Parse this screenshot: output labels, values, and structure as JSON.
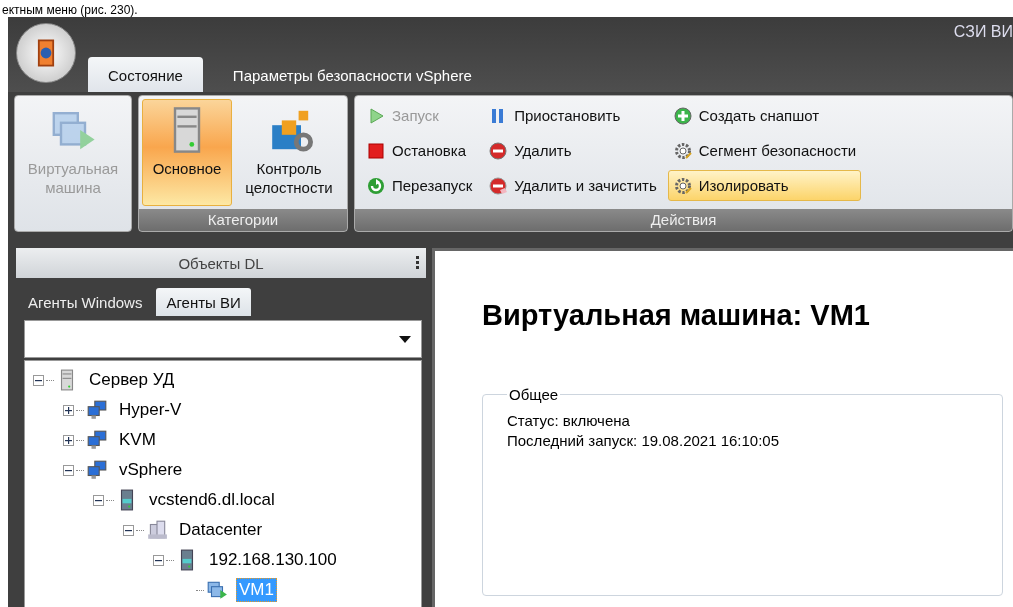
{
  "document_text": "ектным меню (рис. 230).",
  "window": {
    "title": "СЗИ ВИ"
  },
  "tabs": [
    {
      "label": "Состояние",
      "selected": true
    },
    {
      "label": "Параметры безопасности vSphere",
      "selected": false
    }
  ],
  "ribbon": {
    "groups": [
      {
        "buttons": [
          {
            "label": "Виртуальная машина",
            "kind": "vm",
            "disabled": true,
            "selected": false
          }
        ]
      },
      {
        "label": "Категории",
        "buttons": [
          {
            "label": "Основное",
            "kind": "server",
            "disabled": false,
            "selected": true
          },
          {
            "label": "Контроль целостности",
            "kind": "cubes",
            "disabled": false,
            "selected": false
          }
        ]
      }
    ],
    "actions": {
      "label": "Действия",
      "columns": [
        [
          {
            "label": "Запуск",
            "kind": "play",
            "disabled": true,
            "selected": false
          },
          {
            "label": "Остановка",
            "kind": "stop",
            "disabled": false,
            "selected": false
          },
          {
            "label": "Перезапуск",
            "kind": "restart",
            "disabled": false,
            "selected": false
          }
        ],
        [
          {
            "label": "Приостановить",
            "kind": "pause",
            "disabled": false,
            "selected": false
          },
          {
            "label": "Удалить",
            "kind": "delete",
            "disabled": false,
            "selected": false
          },
          {
            "label": "Удалить и зачистить",
            "kind": "erase",
            "disabled": false,
            "selected": false
          }
        ],
        [
          {
            "label": "Создать снапшот",
            "kind": "add",
            "disabled": false,
            "selected": false
          },
          {
            "label": "Сегмент безопасности",
            "kind": "gear",
            "disabled": false,
            "selected": false
          },
          {
            "label": "Изолировать",
            "kind": "gear",
            "disabled": false,
            "selected": true
          }
        ]
      ]
    }
  },
  "objects_panel": {
    "title": "Объекты DL",
    "tabs": [
      {
        "label": "Агенты Windows",
        "selected": false
      },
      {
        "label": "Агенты ВИ",
        "selected": true
      }
    ],
    "tree": [
      {
        "label": "Сервер УД",
        "kind": "server",
        "expanded": true,
        "selected": false,
        "children": [
          {
            "label": "Hyper-V",
            "kind": "cluster",
            "expanded": false,
            "selected": false
          },
          {
            "label": "KVM",
            "kind": "cluster",
            "expanded": false,
            "selected": false
          },
          {
            "label": "vSphere",
            "kind": "cluster",
            "expanded": true,
            "selected": false,
            "children": [
              {
                "label": "vcstend6.dl.local",
                "kind": "host",
                "expanded": true,
                "selected": false,
                "children": [
                  {
                    "label": "Datacenter",
                    "kind": "datacenter",
                    "expanded": true,
                    "selected": false,
                    "children": [
                      {
                        "label": "192.168.130.100",
                        "kind": "host",
                        "expanded": true,
                        "selected": false,
                        "children": [
                          {
                            "label": "VM1",
                            "kind": "vm",
                            "selected": true
                          }
                        ]
                      }
                    ]
                  }
                ]
              }
            ]
          }
        ]
      }
    ]
  },
  "detail": {
    "heading": "Виртуальная машина: VM1",
    "group_title": "Общее",
    "lines": [
      "Статус: включена",
      "Последний запуск: 19.08.2021 16:10:05"
    ]
  }
}
